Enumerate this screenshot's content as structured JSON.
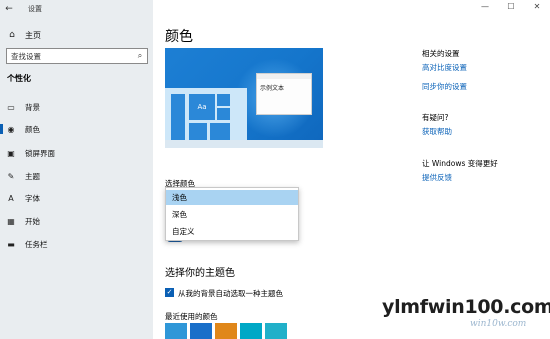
{
  "sidebar": {
    "title": "设置",
    "home": "主页",
    "search_placeholder": "查找设置",
    "section": "个性化",
    "items": [
      {
        "label": "背景",
        "icon": "image-icon"
      },
      {
        "label": "颜色",
        "icon": "palette-icon",
        "active": true
      },
      {
        "label": "锁屏界面",
        "icon": "lock-screen-icon"
      },
      {
        "label": "主题",
        "icon": "brush-icon"
      },
      {
        "label": "字体",
        "icon": "font-icon"
      },
      {
        "label": "开始",
        "icon": "start-icon"
      },
      {
        "label": "任务栏",
        "icon": "taskbar-icon"
      }
    ]
  },
  "main": {
    "title": "颜色",
    "preview": {
      "sample_text": "示例文本",
      "tile_label": "Aa"
    },
    "choose_color_label": "选择颜色",
    "color_options": [
      "浅色",
      "深色",
      "自定义"
    ],
    "selected_option": "浅色",
    "accent_heading": "选择你的主题色",
    "auto_accent_label": "从我的背景自动选取一种主题色",
    "auto_accent_checked": true,
    "recent_colors_heading": "最近使用的颜色",
    "recent_colors": [
      "#2f97d8",
      "#1a6fc9",
      "#e0871a",
      "#00a8c6",
      "#21b0c9"
    ]
  },
  "right": {
    "related_heading": "相关的设置",
    "related_links": [
      "高对比度设置",
      "同步你的设置"
    ],
    "question_heading": "有疑问?",
    "help_link": "获取帮助",
    "improve_heading": "让 Windows 变得更好",
    "feedback_link": "提供反馈"
  },
  "watermark": {
    "main": "ylmfwin100.com",
    "sub": "win10w.com"
  },
  "colors": {
    "accent": "#0a5fb4",
    "sidebar_bg": "#e9edf0",
    "link": "#0a62b8"
  }
}
